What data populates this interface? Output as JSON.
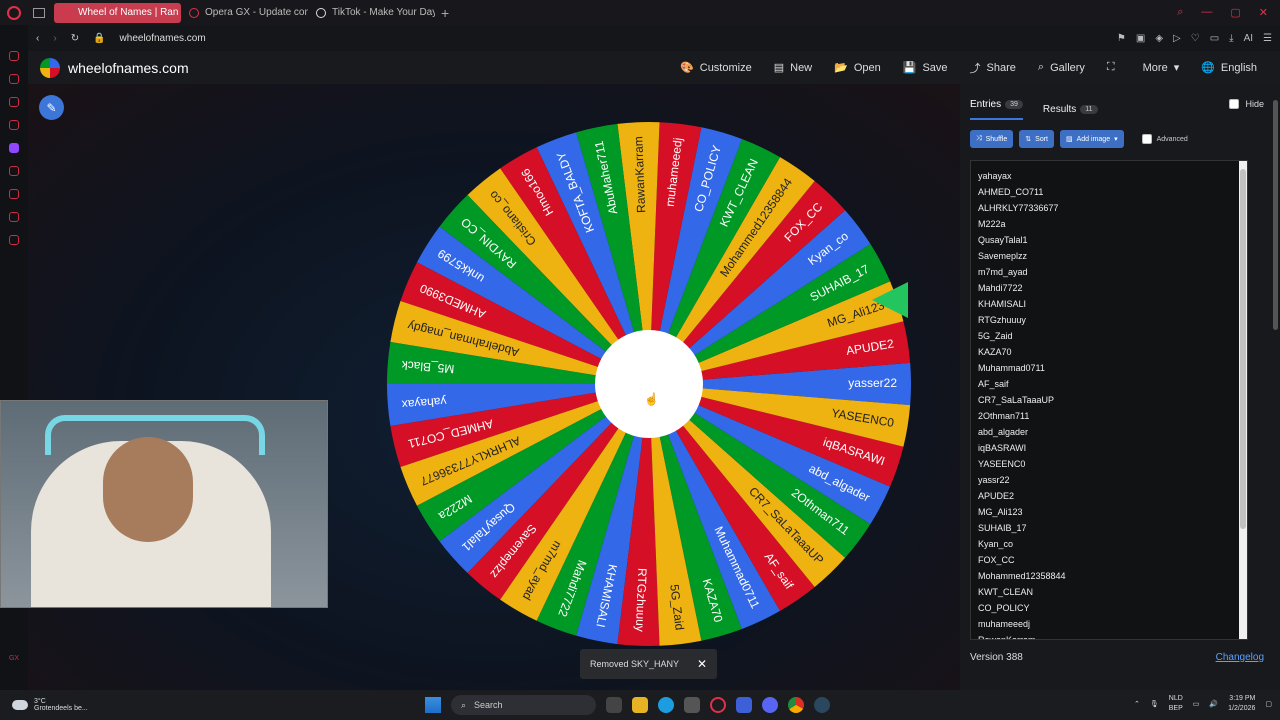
{
  "browser": {
    "tabs": [
      {
        "label": "Wheel of Names | Ran",
        "active": true
      },
      {
        "label": "Opera GX - Update comp",
        "active": false
      },
      {
        "label": "TikTok - Make Your Day",
        "active": false
      }
    ],
    "url": "wheelofnames.com"
  },
  "header": {
    "site_name": "wheelofnames.com",
    "menu": [
      {
        "label": "Customize",
        "icon": "palette-icon"
      },
      {
        "label": "New",
        "icon": "file-icon"
      },
      {
        "label": "Open",
        "icon": "folder-icon"
      },
      {
        "label": "Save",
        "icon": "save-icon"
      },
      {
        "label": "Share",
        "icon": "share-icon"
      },
      {
        "label": "Gallery",
        "icon": "search-icon"
      },
      {
        "label": "",
        "icon": "fullscreen-icon"
      },
      {
        "label": "More",
        "icon": "chevron-down-icon"
      },
      {
        "label": "English",
        "icon": "globe-icon"
      }
    ]
  },
  "wheel": {
    "colors": [
      "#3369e8",
      "#d50f25",
      "#eeb211",
      "#009925"
    ],
    "pointer_color": "#22c55e",
    "segments": [
      "yasser22",
      "APUDE2",
      "MG_Ali123",
      "SUHAIB_17",
      "Kyan_co",
      "FOX_CC",
      "Mohammed12358844",
      "KWT_CLEAN",
      "CO_POLICY",
      "muhameeedj",
      "RawanKarram",
      "AbuMaher711",
      "KOFTA_BALDY",
      "Hmoo166",
      "Cristiano_co",
      "RAYDIN_CO",
      "unkk5799",
      "AHMED3990",
      "Abdelrahman_magdy",
      "M5_Black",
      "yahayax",
      "AHMED_CO711",
      "ALHRKLY77336677",
      "M222a",
      "QusayTalal1",
      "Savemeplzz",
      "m7md_ayad",
      "Mahdi7722",
      "KHAMISALI",
      "RTGzhuuuy",
      "5G_Zaid",
      "KAZA70",
      "Muhammad0711",
      "AF_saif",
      "CR7_SaLaTaaaUP",
      "2Othman711",
      "abd_algader",
      "iqBASRAWI",
      "YASEENC0"
    ]
  },
  "toast": {
    "text": "Removed SKY_HANY",
    "close": "✕"
  },
  "panel": {
    "entries_tab": "Entries",
    "entries_count": "39",
    "results_tab": "Results",
    "results_count": "11",
    "hide_label": "Hide",
    "shuffle": "Shuffle",
    "sort": "Sort",
    "add_image": "Add image",
    "advanced": "Advanced",
    "entries": [
      "yahayax",
      "AHMED_CO711",
      "ALHRKLY77336677",
      "M222a",
      "QusayTalal1",
      "Savemeplzz",
      "m7md_ayad",
      "Mahdi7722",
      "KHAMISALI",
      "RTGzhuuuy",
      "5G_Zaid",
      "KAZA70",
      "Muhammad0711",
      "AF_saif",
      "CR7_SaLaTaaaUP",
      "2Othman711",
      "abd_algader",
      "iqBASRAWI",
      "YASEENC0",
      "yassr22",
      "APUDE2",
      "MG_Ali123",
      "SUHAIB_17",
      "Kyan_co",
      "FOX_CC",
      "Mohammed12358844",
      "KWT_CLEAN",
      "CO_POLICY",
      "muhameeedj",
      "RawanKarram"
    ],
    "version": "Version 388",
    "changelog": "Changelog"
  },
  "taskbar": {
    "temp": "3°C",
    "weather": "Grotendeels be...",
    "search": "Search",
    "lang1": "NLD",
    "lang2": "BEP",
    "time": "3:19 PM",
    "date": "1/2/2026"
  }
}
